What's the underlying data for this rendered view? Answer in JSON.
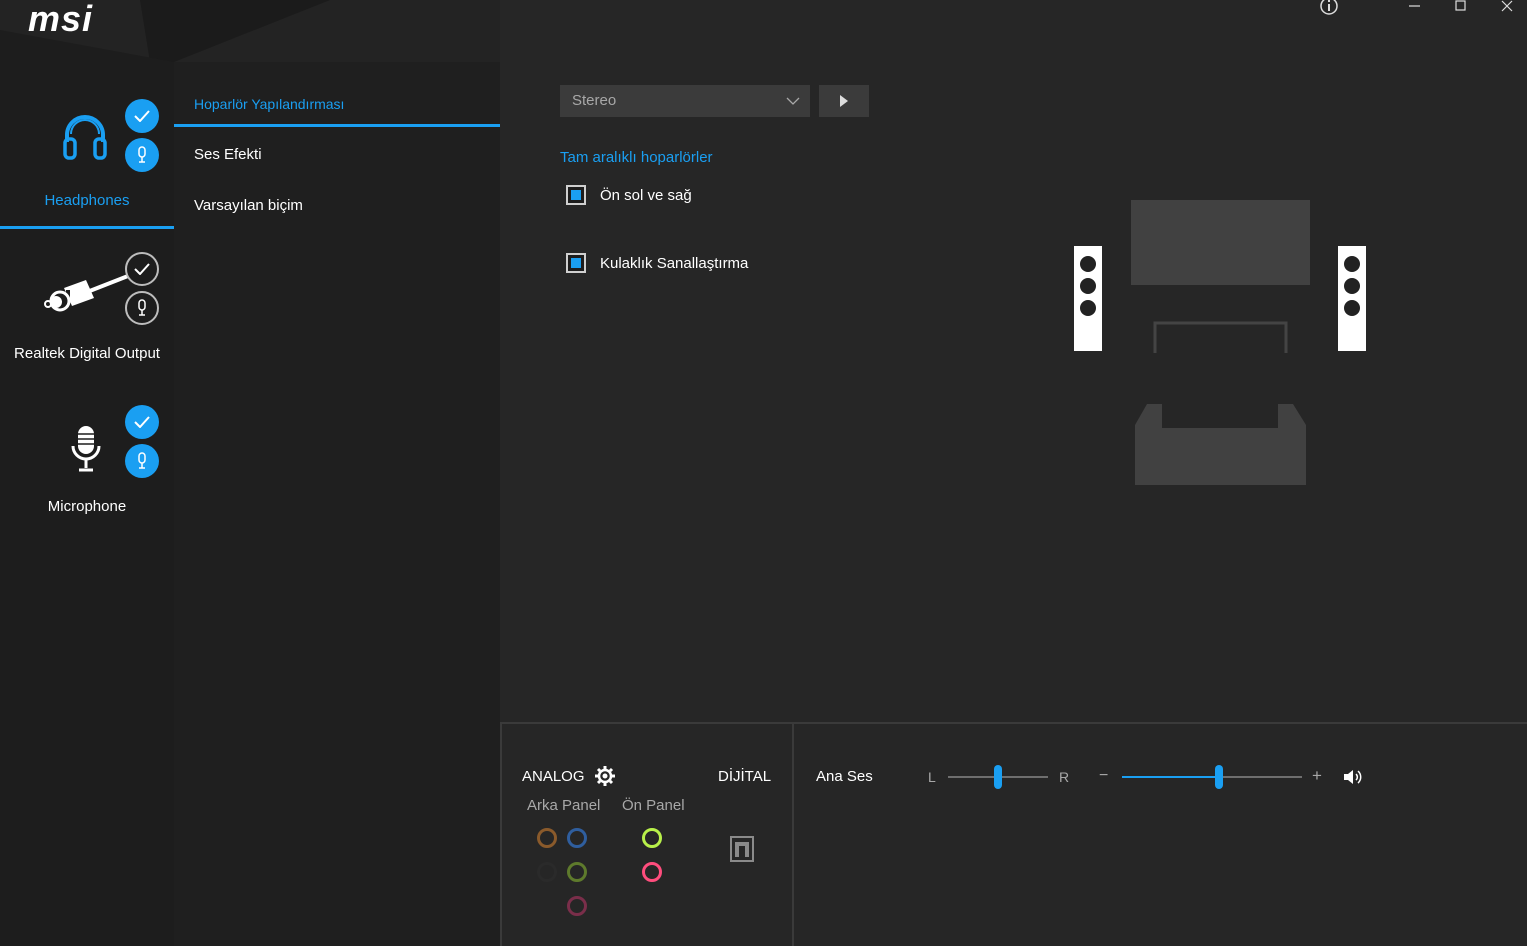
{
  "brand": {
    "logo": "msi"
  },
  "devices": [
    {
      "label": "Headphones",
      "icon": "headphones-icon",
      "active": true,
      "default_device": true,
      "default_comm": true
    },
    {
      "label": "Realtek Digital Output",
      "icon": "optical-cable-icon",
      "active": false,
      "default_device": false,
      "default_comm": false
    },
    {
      "label": "Microphone",
      "icon": "microphone-icon",
      "active": false,
      "default_device": true,
      "default_comm": true
    }
  ],
  "menu": {
    "items": [
      "Hoparlör Yapılandırması",
      "Ses Efekti",
      "Varsayılan biçim"
    ],
    "active_index": 0
  },
  "window": {
    "info": "info-icon",
    "minimize": "minimize-icon",
    "maximize": "maximize-icon",
    "close": "close-icon"
  },
  "config": {
    "speaker_mode": "Stereo",
    "full_range_title": "Tam aralıklı hoparlörler",
    "options": [
      {
        "label": "Ön sol ve sağ",
        "checked": true
      },
      {
        "label": "Kulaklık Sanallaştırma",
        "checked": true
      }
    ]
  },
  "bottom": {
    "analog_label": "ANALOG",
    "digital_label": "DİJİTAL",
    "rear_panel": "Arka Panel",
    "front_panel": "Ön Panel",
    "rear_jacks": [
      "#8a5a2b",
      "#2f5e9e",
      "#2a2a2a",
      "#5e7a2c",
      "#7a2e4a"
    ],
    "front_jacks": [
      "#b8f04a",
      "#ff4d7d"
    ],
    "master_label": "Ana Ses",
    "balance_left": "L",
    "balance_right": "R",
    "balance_value": 0.5,
    "volume_minus": "−",
    "volume_plus": "+",
    "volume_value": 0.54,
    "accent": "#1a9ff2"
  }
}
